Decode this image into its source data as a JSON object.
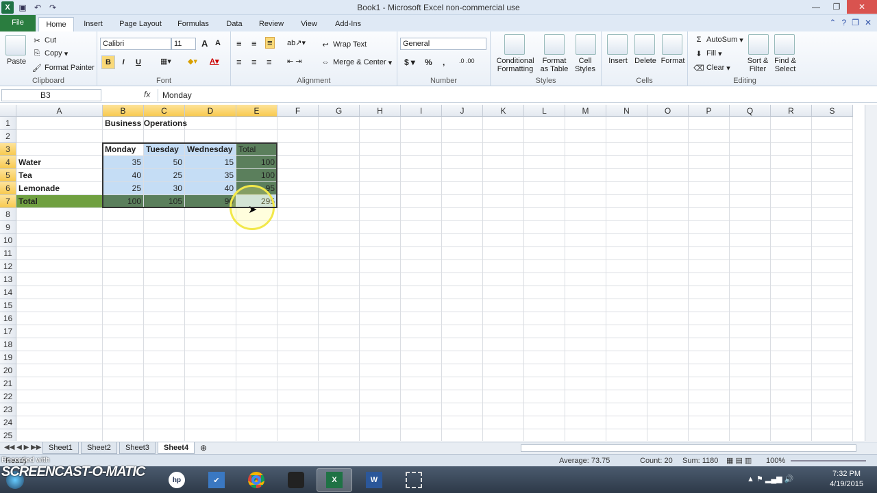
{
  "window": {
    "title": "Book1 - Microsoft Excel non-commercial use"
  },
  "tabs": [
    "File",
    "Home",
    "Insert",
    "Page Layout",
    "Formulas",
    "Data",
    "Review",
    "View",
    "Add-Ins"
  ],
  "ribbon": {
    "clipboard": {
      "label": "Clipboard",
      "paste": "Paste",
      "cut": "Cut",
      "copy": "Copy",
      "format_painter": "Format Painter"
    },
    "font": {
      "label": "Font",
      "name": "Calibri",
      "size": "11",
      "bold": "B",
      "italic": "I",
      "underline": "U"
    },
    "alignment": {
      "label": "Alignment",
      "wrap": "Wrap Text",
      "merge": "Merge & Center"
    },
    "number": {
      "label": "Number",
      "format": "General",
      "currency": "$",
      "percent": "%",
      "comma": ","
    },
    "styles": {
      "label": "Styles",
      "conditional": "Conditional",
      "conditional2": "Formatting",
      "format_as": "Format",
      "format_as2": "as Table",
      "cell": "Cell",
      "cell2": "Styles"
    },
    "cells": {
      "label": "Cells",
      "insert": "Insert",
      "delete": "Delete",
      "format": "Format"
    },
    "editing": {
      "label": "Editing",
      "autosum": "AutoSum",
      "fill": "Fill",
      "clear": "Clear",
      "sort": "Sort &",
      "sort2": "Filter",
      "find": "Find &",
      "find2": "Select"
    }
  },
  "formula_bar": {
    "name_box": "B3",
    "fx": "fx",
    "value": "Monday"
  },
  "columns": [
    "A",
    "B",
    "C",
    "D",
    "E",
    "F",
    "G",
    "H",
    "I",
    "J",
    "K",
    "L",
    "M",
    "N",
    "O",
    "P",
    "Q",
    "R",
    "S"
  ],
  "rows": [
    "1",
    "2",
    "3",
    "4",
    "5",
    "6",
    "7",
    "8",
    "9",
    "10",
    "11",
    "12",
    "13",
    "14",
    "15",
    "16",
    "17",
    "18",
    "19",
    "20",
    "21",
    "22",
    "23",
    "24",
    "25"
  ],
  "sheet": {
    "title": "Business Operations",
    "headers": [
      "Monday",
      "Tuesday",
      "Wednesday",
      "Total"
    ],
    "items": [
      {
        "label": "Water",
        "values": [
          "35",
          "50",
          "15",
          "100"
        ]
      },
      {
        "label": "Tea",
        "values": [
          "40",
          "25",
          "35",
          "100"
        ]
      },
      {
        "label": "Lemonade",
        "values": [
          "25",
          "30",
          "40",
          "95"
        ]
      },
      {
        "label": "Total",
        "values": [
          "100",
          "105",
          "90",
          "295"
        ]
      }
    ]
  },
  "sheet_tabs": [
    "Sheet1",
    "Sheet2",
    "Sheet3",
    "Sheet4"
  ],
  "status": {
    "ready": "Ready",
    "average": "Average: 73.75",
    "count": "Count: 20",
    "sum": "Sum: 1180",
    "zoom": "100%"
  },
  "watermark": {
    "line1": "Recorded with",
    "brand": "SCREENCAST-O-MATIC"
  },
  "clock": {
    "time": "7:32 PM",
    "date": "4/19/2015"
  }
}
